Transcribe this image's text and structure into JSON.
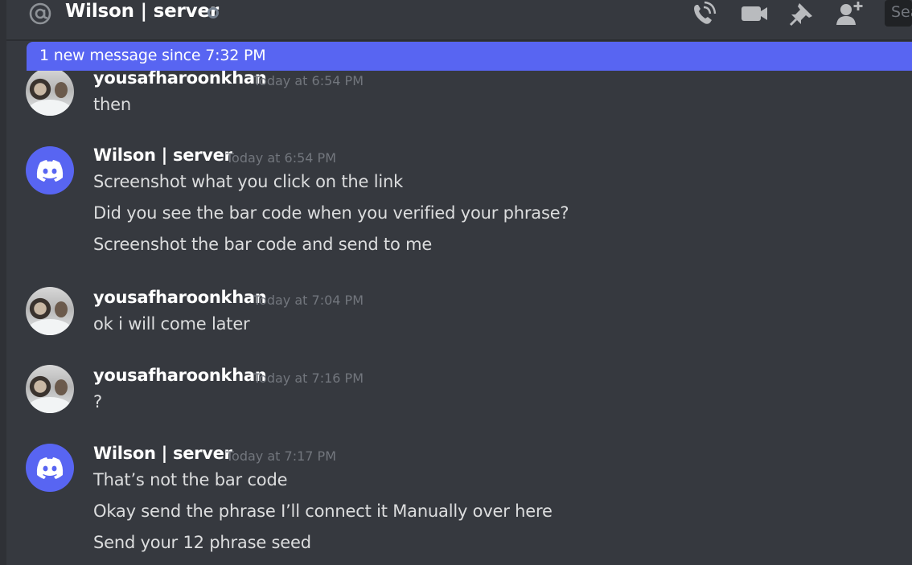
{
  "header": {
    "channel_title": "Wilson | server",
    "search_placeholder": "Search",
    "icons": [
      "at-icon",
      "status-icon",
      "call-icon",
      "video-icon",
      "pin-icon",
      "add-friend-icon"
    ]
  },
  "new_messages_bar": {
    "text": "1 new message since 7:32 PM"
  },
  "colors": {
    "accent": "#5865f2",
    "background": "#36393f",
    "username": "#ffffff",
    "timestamp": "#72767d"
  },
  "messages": [
    {
      "username": "yousafharoonkhan",
      "timestamp": "Today at 6:54 PM",
      "lines": [
        "then"
      ]
    },
    {
      "username": "Wilson | server",
      "timestamp": "Today at 6:54 PM",
      "lines": [
        "Screenshot what you click on the link",
        "Did you see the bar code when you verified your phrase?",
        "Screenshot the bar code and send to me"
      ]
    },
    {
      "username": "yousafharoonkhan",
      "timestamp": "Today at 7:04 PM",
      "lines": [
        "ok i will come later"
      ]
    },
    {
      "username": "yousafharoonkhan",
      "timestamp": "Today at 7:16 PM",
      "lines": [
        "?"
      ]
    },
    {
      "username": "Wilson | server",
      "timestamp": "Today at 7:17 PM",
      "lines": [
        "That’s not the bar code",
        "Okay send the phrase I’ll connect it Manually over here",
        "Send your 12 phrase seed"
      ]
    }
  ]
}
